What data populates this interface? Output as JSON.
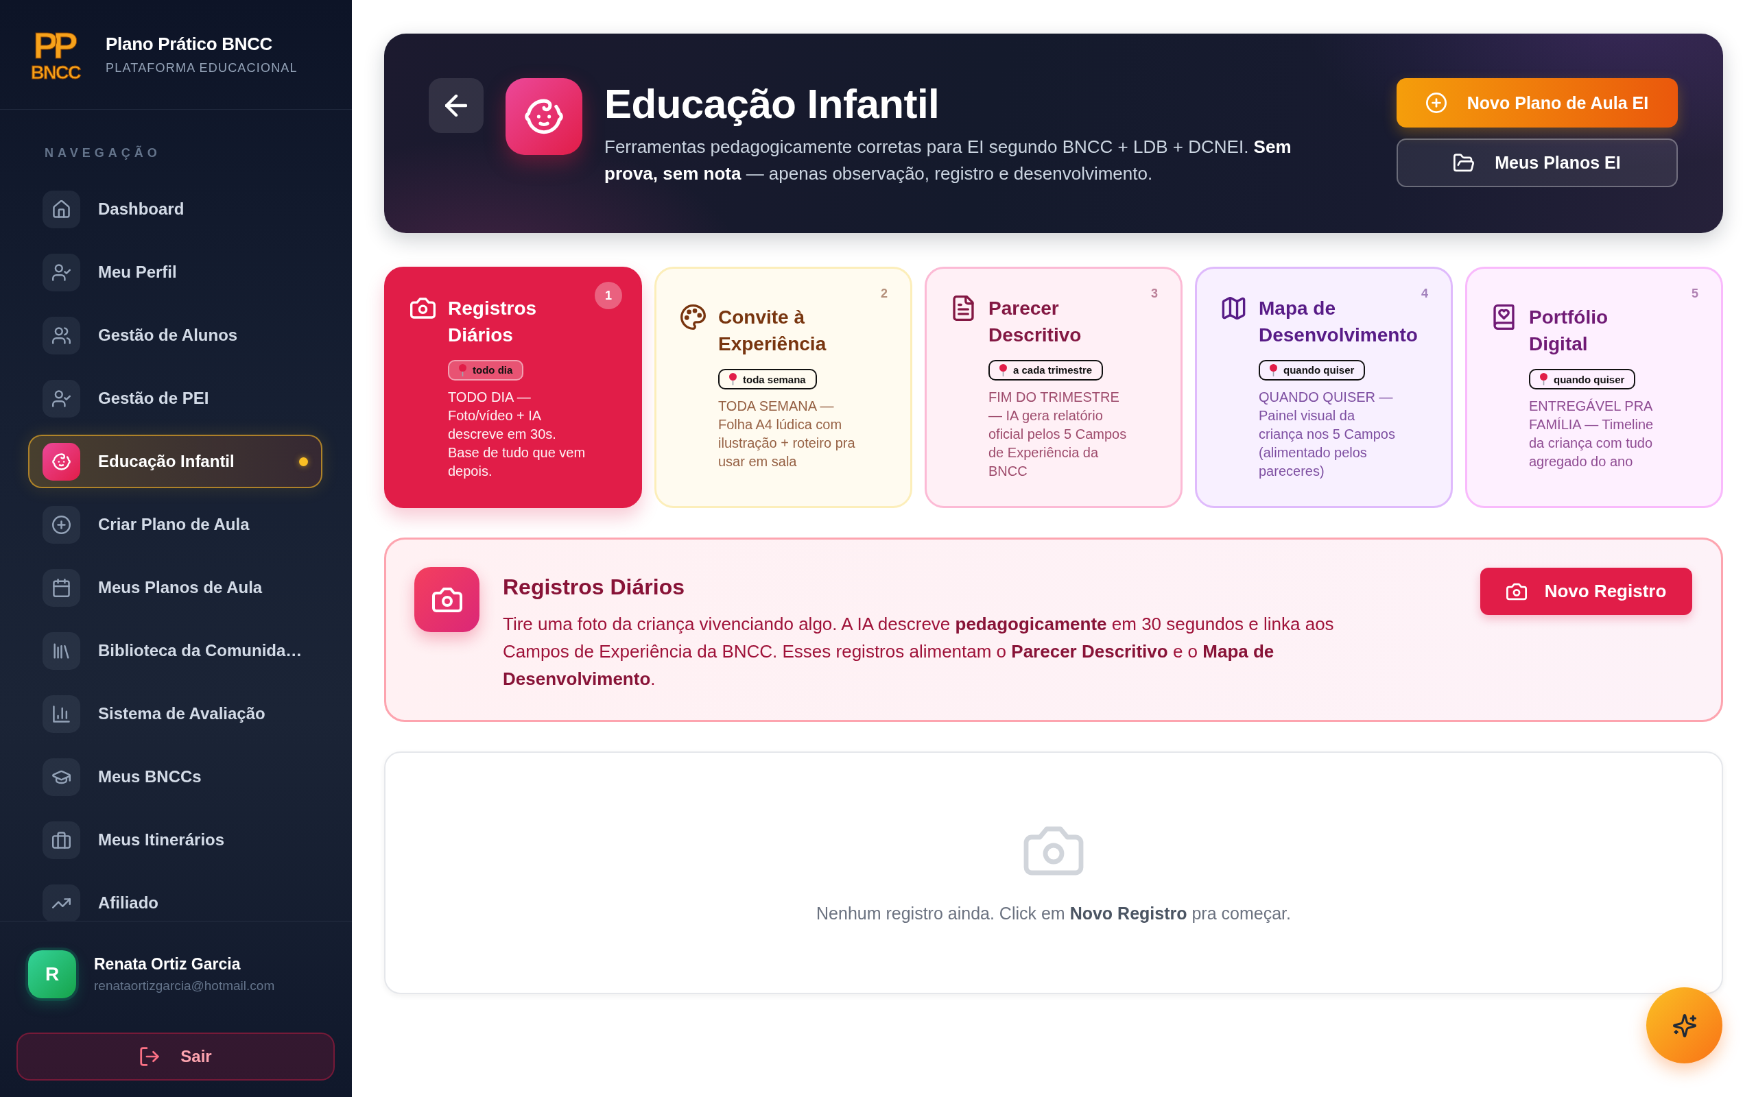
{
  "sidebar": {
    "logo": {
      "top": "PP",
      "bottom": "BNCC"
    },
    "app_name": "Plano Prático BNCC",
    "app_subtitle": "PLATAFORMA EDUCACIONAL",
    "section_label": "NAVEGAÇÃO",
    "items": [
      {
        "label": "Dashboard",
        "selected": false
      },
      {
        "label": "Meu Perfil",
        "selected": false
      },
      {
        "label": "Gestão de Alunos",
        "selected": false
      },
      {
        "label": "Gestão de PEI",
        "selected": false
      },
      {
        "label": "Educação Infantil",
        "selected": true
      },
      {
        "label": "Criar Plano de Aula",
        "selected": false
      },
      {
        "label": "Meus Planos de Aula",
        "selected": false
      },
      {
        "label": "Biblioteca da Comunida…",
        "selected": false
      },
      {
        "label": "Sistema de Avaliação",
        "selected": false
      },
      {
        "label": "Meus BNCCs",
        "selected": false
      },
      {
        "label": "Meus Itinerários",
        "selected": false
      },
      {
        "label": "Afiliado",
        "selected": false
      }
    ],
    "user": {
      "avatar_letter": "R",
      "name": "Renata Ortiz Garcia",
      "email": "renataortizgarcia@hotmail.com"
    },
    "logout_button": "Sair"
  },
  "header": {
    "title": "Educação Infantil",
    "description": "Ferramentas pedagogicamente corretas para EI segundo BNCC + LDB + DCNEI. **Sem prova, sem nota** — apenas observação, registro e desenvolvimento.",
    "buttons": [
      {
        "label": "Novo Plano de Aula EI",
        "kind": "primary"
      },
      {
        "label": "Meus Planos EI",
        "kind": "secondary"
      }
    ]
  },
  "tools": [
    {
      "number": "1",
      "title": "Registros Diários",
      "tag": "todo dia",
      "description": "TODO DIA — Foto/vídeo + IA descreve em 30s. Base de tudo que vem depois.",
      "selected": true,
      "color": "#e11d48"
    },
    {
      "number": "2",
      "title": "Convite à Experiência",
      "tag": "toda semana",
      "description": "TODA SEMANA — Folha A4 lúdica com ilustração + roteiro pra usar em sala",
      "selected": false,
      "color": "#78350f"
    },
    {
      "number": "3",
      "title": "Parecer Descritivo",
      "tag": "a cada trimestre",
      "description": "FIM DO TRIMESTRE — IA gera relatório oficial pelos 5 Campos de Experiência da BNCC",
      "selected": false,
      "color": "#831843"
    },
    {
      "number": "4",
      "title": "Mapa de Desenvolvimento",
      "tag": "quando quiser",
      "description": "QUANDO QUISER — Painel visual da criança nos 5 Campos (alimentado pelos pareceres)",
      "selected": false,
      "color": "#581c87"
    },
    {
      "number": "5",
      "title": "Portfólio Digital",
      "tag": "quando quiser",
      "description": "ENTREGÁVEL PRA FAMÍLIA — Timeline da criança com tudo agregado do ano",
      "selected": false,
      "color": "#701a75"
    }
  ],
  "detail": {
    "title": "Registros Diários",
    "description": "Tire uma foto da criança vivenciando algo. A IA descreve **pedagogicamente** em 30 segundos e linka aos Campos de Experiência da BNCC. Esses registros alimentam o **Parecer Descritivo** e o **Mapa de Desenvolvimento**.",
    "button": "Novo Registro"
  },
  "records": {
    "empty_message": "Nenhum registro ainda. Click em **Novo Registro** pra começar."
  }
}
